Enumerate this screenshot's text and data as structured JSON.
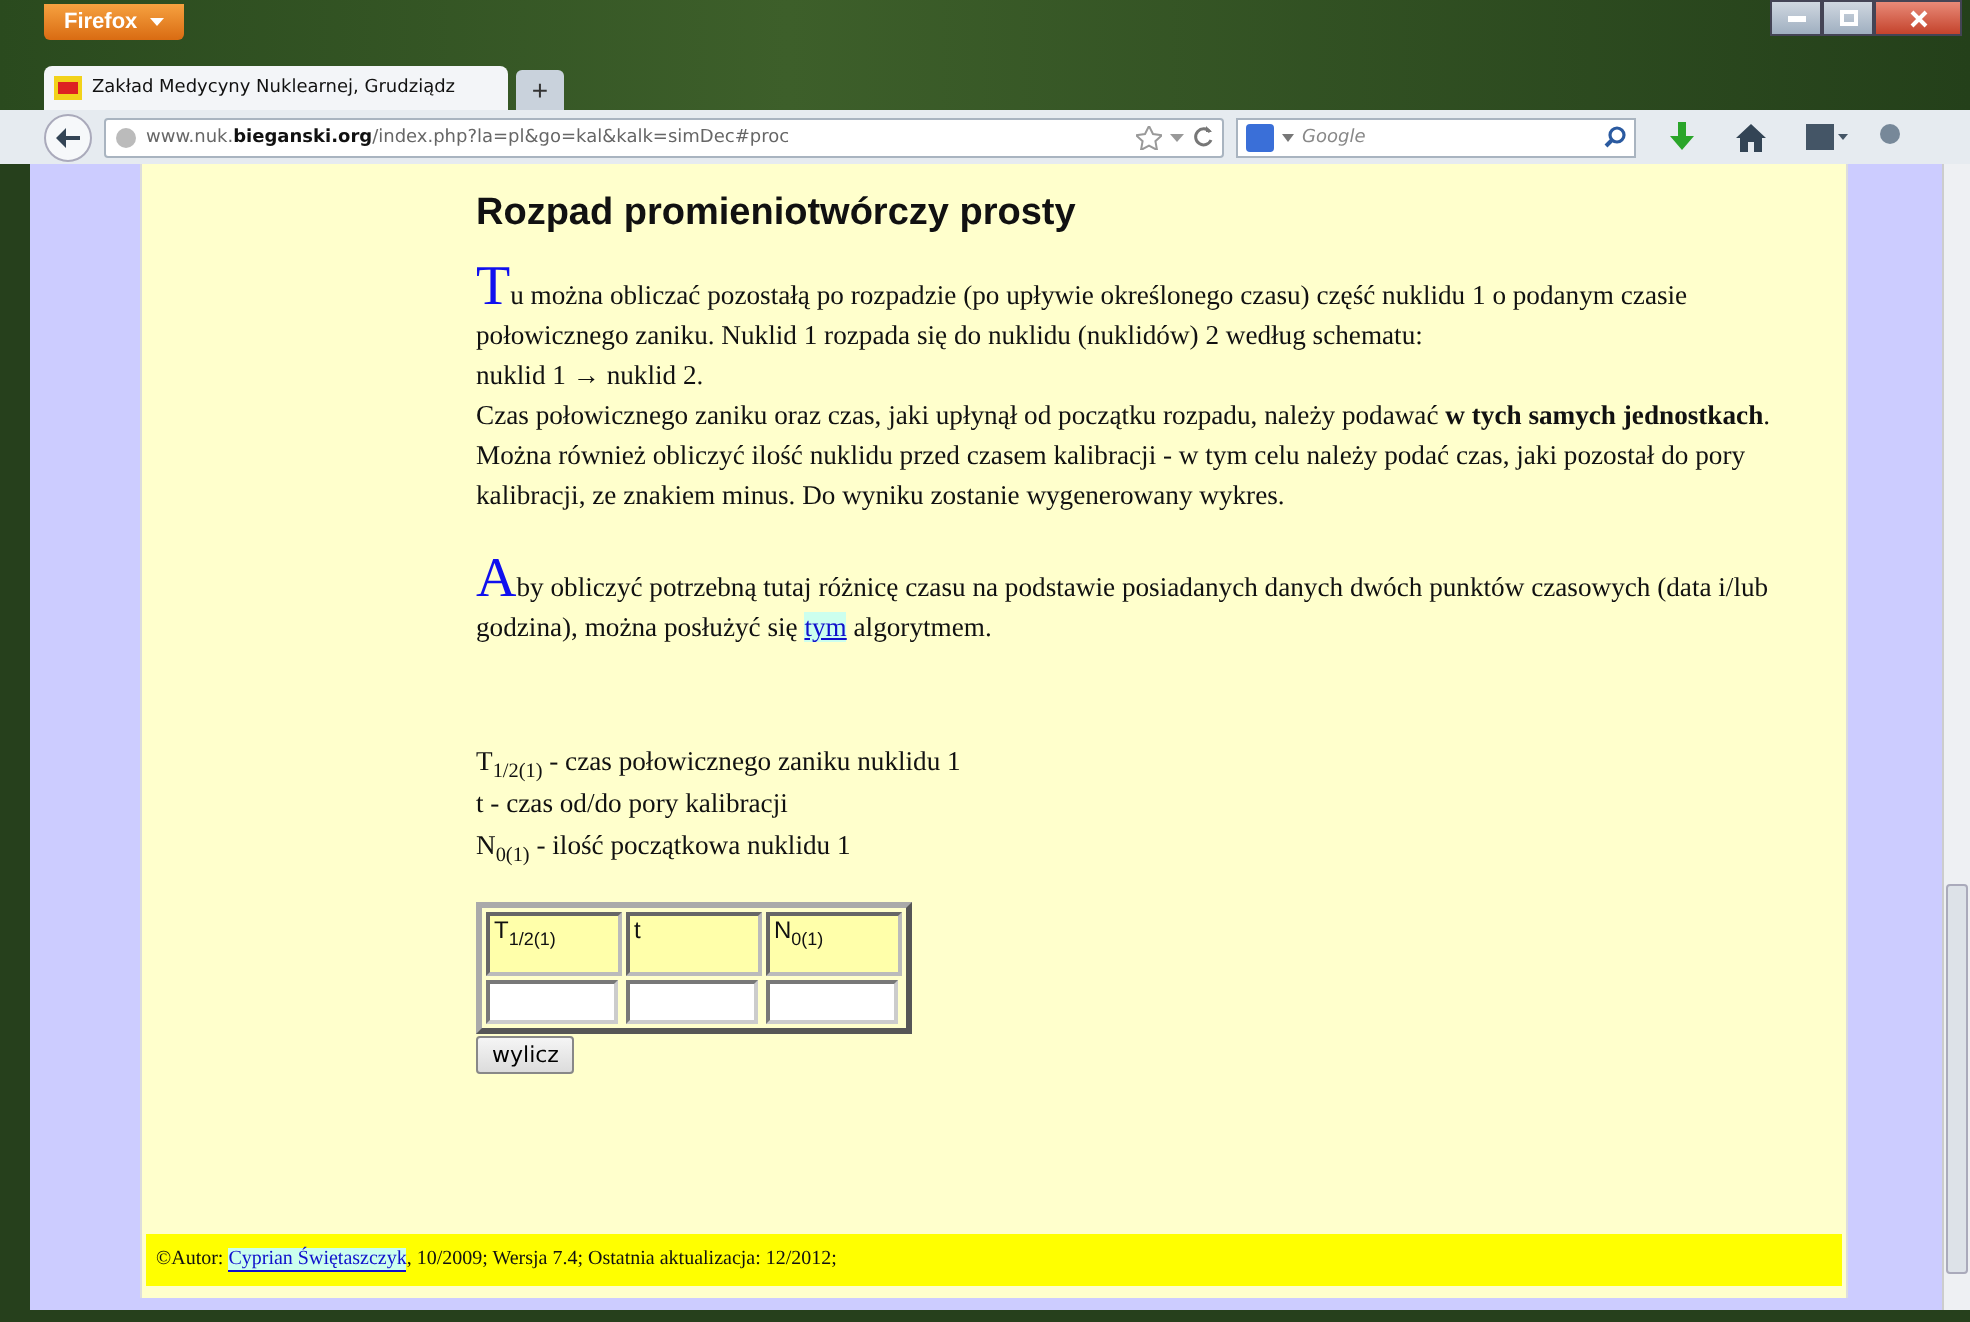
{
  "browser": {
    "menu_button": "Firefox",
    "tab_title": "Zakład Medycyny Nuklearnej, Grudziądz",
    "address": "www.nuk.**bieganski.org**/index.php?la=pl&go=kal&kalk=simDec#proc",
    "search_placeholder": "Google",
    "new_tab": "+"
  },
  "heading": "Rozpad promieniotwórczy prosty",
  "paragraphs": [
    {
      "lead": "T",
      "lines": [
        "u można obliczać pozostałą po rozpadzie (po upływie określonego czasu) część nuklidu 1 o podanym czasie połowicznego zaniku. Nuklid 1 rozpada się do nuklidu (nuklidów) 2 według schematu:",
        "nuklid 1 → nuklid 2.",
        "Czas połowicznego zaniku oraz czas, jaki upłynął od początku rozpadu, należy podawać **w tych samych jednostkach**. Można również obliczyć ilość nuklidu przed czasem kalibracji - w tym celu należy podać czas, jaki pozostał do pory kalibracji, ze znakiem minus. Do wyniku zostanie wygenerowany wykres."
      ]
    },
    {
      "lead": "A",
      "lines": [
        "by obliczyć potrzebną tutaj różnicę czasu na podstawie posiadanych danych dwóch punktów czasowych (data i/lub godzina), można posłużyć się "
      ],
      "link": "tym",
      "after": " algorytmem."
    }
  ],
  "legend": [
    "T$_{1/2(1)}$ - czas połowicznego zaniku nuklidu 1",
    "t - czas od/do pory kalibracji",
    "N$_{0(1)}$ - ilość początkowa nuklidu 1"
  ],
  "form": {
    "columns": [
      "T$_{1/2(1)}$",
      "t",
      "N$_{0(1)}$"
    ],
    "button": "wylicz"
  },
  "footer": {
    "before": "©Autor: ",
    "link": "Cyprian Świętaszczyk",
    "after": ", 10/2009; Wersja 7.4; Ostatnia aktualizacja: 12/2012;"
  }
}
